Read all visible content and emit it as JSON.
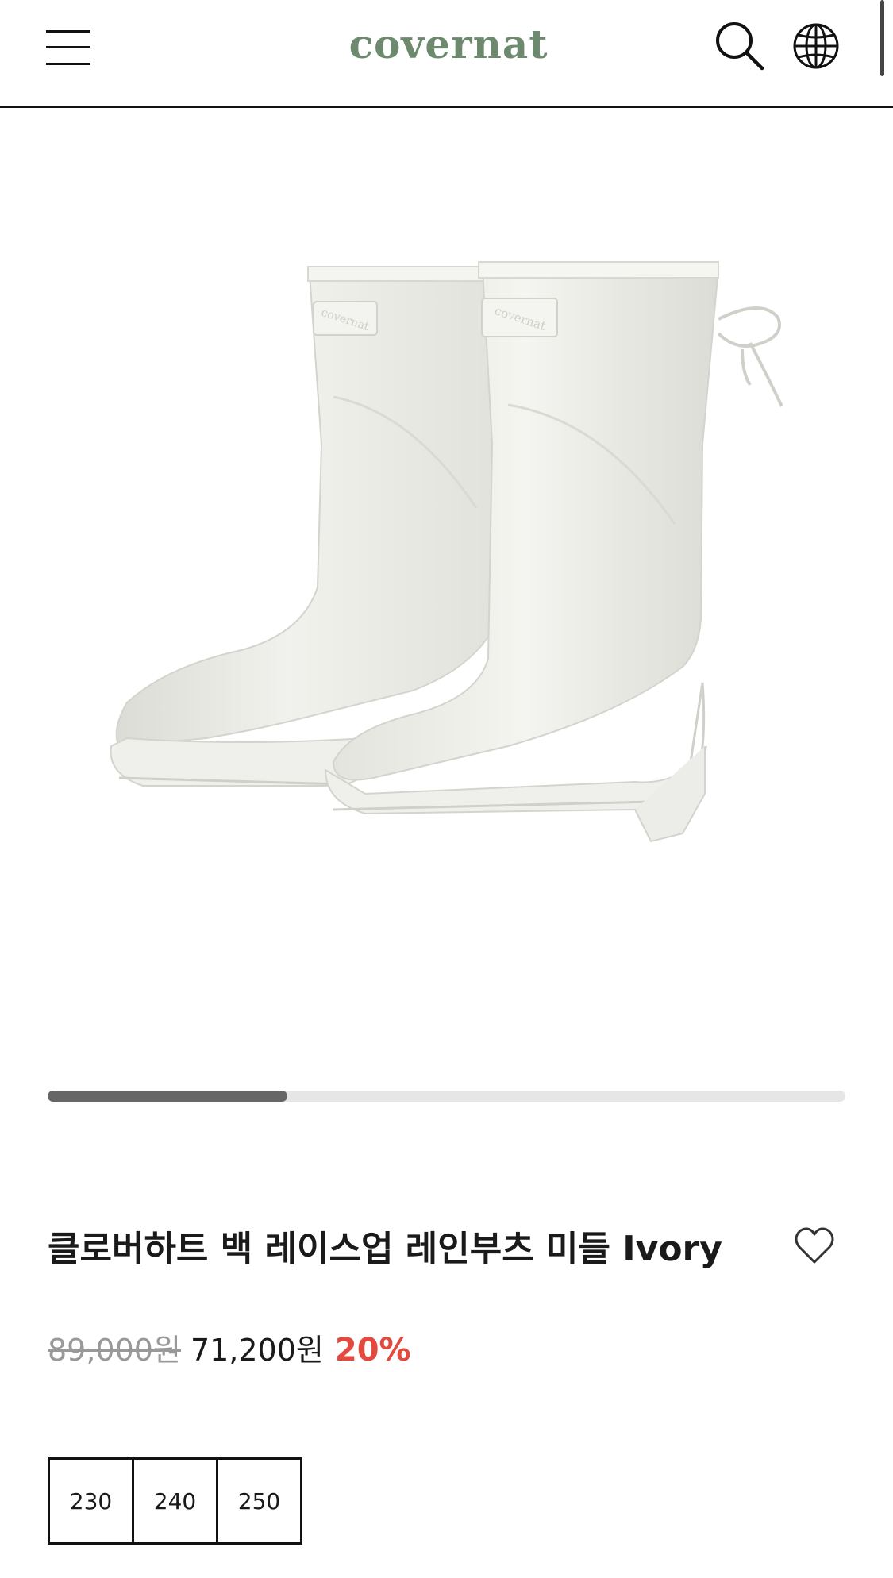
{
  "header": {
    "logo_text": "covernat",
    "menu_icon": "hamburger-menu-icon",
    "search_icon": "search-icon",
    "language_icon": "globe-icon"
  },
  "product": {
    "image_alt": "ivory rain boots",
    "title": "클로버하트 백 레이스업 레인부츠 미들 Ivory",
    "wishlist_icon": "heart-outline-icon",
    "price": {
      "original": "89,000원",
      "sale": "71,200원",
      "discount": "20%"
    },
    "carousel": {
      "progress": 0.3
    },
    "sizes": [
      "230",
      "240",
      "250"
    ]
  },
  "colors": {
    "brand": "#6e8a6e",
    "discount": "#e34a3f",
    "boot": "#ecece7"
  }
}
